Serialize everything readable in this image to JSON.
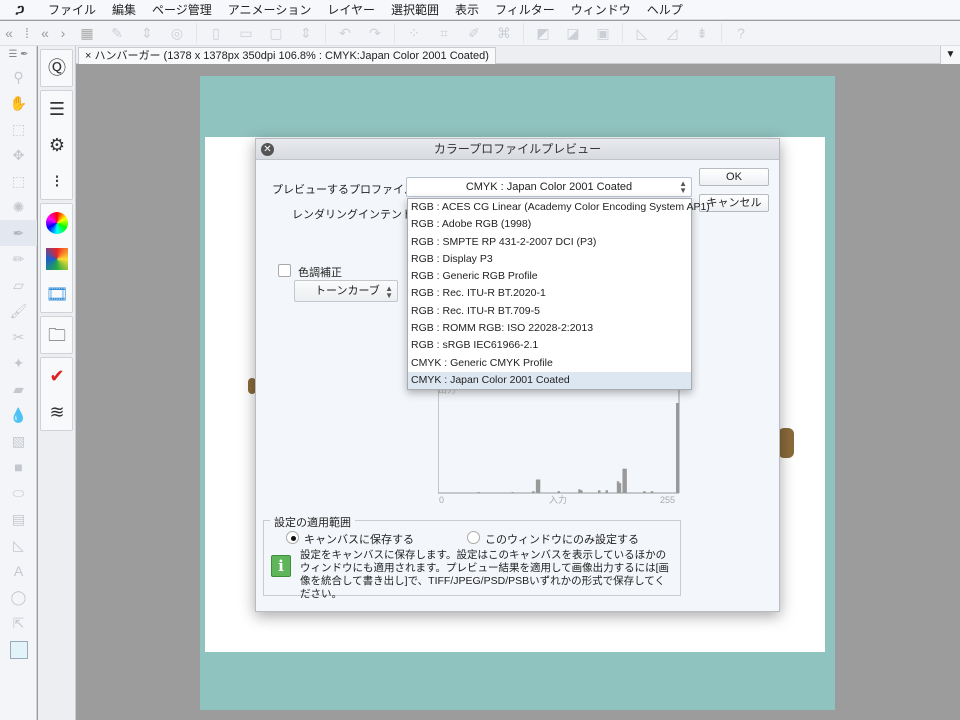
{
  "menu": [
    "ファイル",
    "編集",
    "ページ管理",
    "アニメーション",
    "レイヤー",
    "選択範囲",
    "表示",
    "フィルター",
    "ウィンドウ",
    "ヘルプ"
  ],
  "document_tab": "ハンバーガー (1378 x 1378px 350dpi 106.8% : CMYK:Japan Color 2001 Coated)",
  "dialog": {
    "title": "カラープロファイルプレビュー",
    "profile_label": "プレビューするプロファイル:",
    "profile_value": "CMYK : Japan Color 2001 Coated",
    "intent_label": "レンダリングインテント:",
    "ok": "OK",
    "cancel": "キャンセル",
    "tone_label": "色調補正",
    "tone_checked": false,
    "tone_select": "トーンカーブ",
    "profile_options": [
      "RGB : ACES CG Linear (Academy Color Encoding System AP1)",
      "RGB : Adobe RGB (1998)",
      "RGB : SMPTE RP 431-2-2007 DCI (P3)",
      "RGB : Display P3",
      "RGB : Generic RGB Profile",
      "RGB : Rec. ITU-R BT.2020-1",
      "RGB : Rec. ITU-R BT.709-5",
      "RGB : ROMM RGB: ISO 22028-2:2013",
      "RGB : sRGB IEC61966-2.1",
      "CMYK : Generic CMYK Profile",
      "CMYK : Japan Color 2001 Coated"
    ],
    "selected_option": 10,
    "histogram": {
      "y_label": "出力",
      "y_min_label": "0",
      "x_label": "入力",
      "x_min_label": "0",
      "x_max_label": "255",
      "bins": [
        [
          42,
          0.01
        ],
        [
          78,
          0.01
        ],
        [
          100,
          0.02
        ],
        [
          104,
          0.15
        ],
        [
          106,
          0.15
        ],
        [
          127,
          0.02
        ],
        [
          149,
          0.04
        ],
        [
          151,
          0.03
        ],
        [
          170,
          0.03
        ],
        [
          178,
          0.03
        ],
        [
          190,
          0.13
        ],
        [
          192,
          0.11
        ],
        [
          196,
          0.27
        ],
        [
          198,
          0.27
        ],
        [
          218,
          0.02
        ],
        [
          226,
          0.02
        ],
        [
          254,
          1.0
        ]
      ]
    },
    "scope": {
      "legend": "設定の適用範囲",
      "option_canvas": "キャンバスに保存する",
      "option_window": "このウィンドウにのみ設定する",
      "selected": "canvas",
      "info": "設定をキャンバスに保存します。設定はこのキャンバスを表示しているほかのウィンドウにも適用されます。プレビュー結果を適用して画像出力するには[画像を統合して書き出し]で、TIFF/JPEG/PSD/PSBいずれかの形式で保存してください。"
    }
  }
}
